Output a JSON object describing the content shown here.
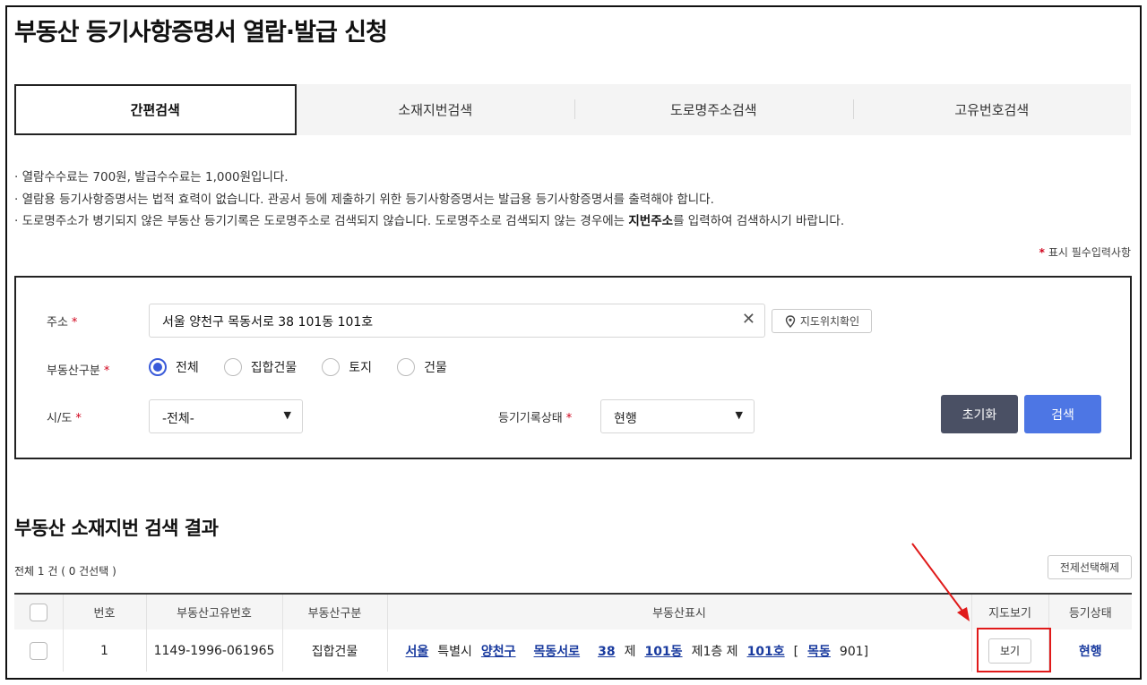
{
  "page": {
    "title": "부동산 등기사항증명서 열람·발급 신청"
  },
  "tabs": [
    {
      "label": "간편검색",
      "active": true
    },
    {
      "label": "소재지번검색",
      "active": false
    },
    {
      "label": "도로명주소검색",
      "active": false
    },
    {
      "label": "고유번호검색",
      "active": false
    }
  ],
  "notices": {
    "line1": "· 열람수수료는  700원, 발급수수료는  1,000원입니다.",
    "line2": "· 열람용 등기사항증명서는 법적 효력이 없습니다. 관공서 등에 제출하기 위한 등기사항증명서는 발급용 등기사항증명서를 출력해야 합니다.",
    "line3_pre": "· 도로명주소가 병기되지 않은 부동산 등기기록은 도로명주소로 검색되지 않습니다. 도로명주소로 검색되지 않는 경우에는 ",
    "line3_bold": "지번주소",
    "line3_post": "를 입력하여 검색하시기 바랍니다."
  },
  "required_note": {
    "star": "*",
    "text": "표시 필수입력사항"
  },
  "form": {
    "address_label": "주소",
    "address_value": "서울 양천구 목동서로 38 101동 101호",
    "clear_glyph": "✕",
    "map_button": "지도위치확인",
    "type_label": "부동산구분",
    "type_options": [
      "전체",
      "집합건물",
      "토지",
      "건물"
    ],
    "type_selected": "전체",
    "sido_label": "시/도",
    "sido_value": "-전체-",
    "status_label": "등기기록상태",
    "status_value": "현행",
    "required_star": "*",
    "reset_button": "초기화",
    "search_button": "검색"
  },
  "results": {
    "title": "부동산 소재지번 검색 결과",
    "count_text": "전체 1 건 ( 0 건선택 )",
    "deselect_button": "전제선택해제",
    "columns": [
      "번호",
      "부동산고유번호",
      "부동산구분",
      "부동산표시",
      "지도보기",
      "등기상태"
    ],
    "rows": [
      {
        "no": "1",
        "unique_no": "1149-1996-061965",
        "type": "집합건물",
        "addr": {
          "sido": "서울",
          "sido_type": "특별시",
          "gu": "양천구",
          "road": "목동서로",
          "num": "38",
          "je1": "제",
          "dong": "101동",
          "floor": "제1층 제",
          "ho": "101호",
          "bracket_open": "[",
          "legal_dong": "목동",
          "lot": "901]"
        },
        "map_button": "보기",
        "status": "현행"
      }
    ]
  },
  "colors": {
    "accent": "#4d76e4",
    "reset": "#4a5064",
    "link": "#1a3b9f",
    "required": "#d0021b",
    "annotation": "#e01a1a"
  }
}
